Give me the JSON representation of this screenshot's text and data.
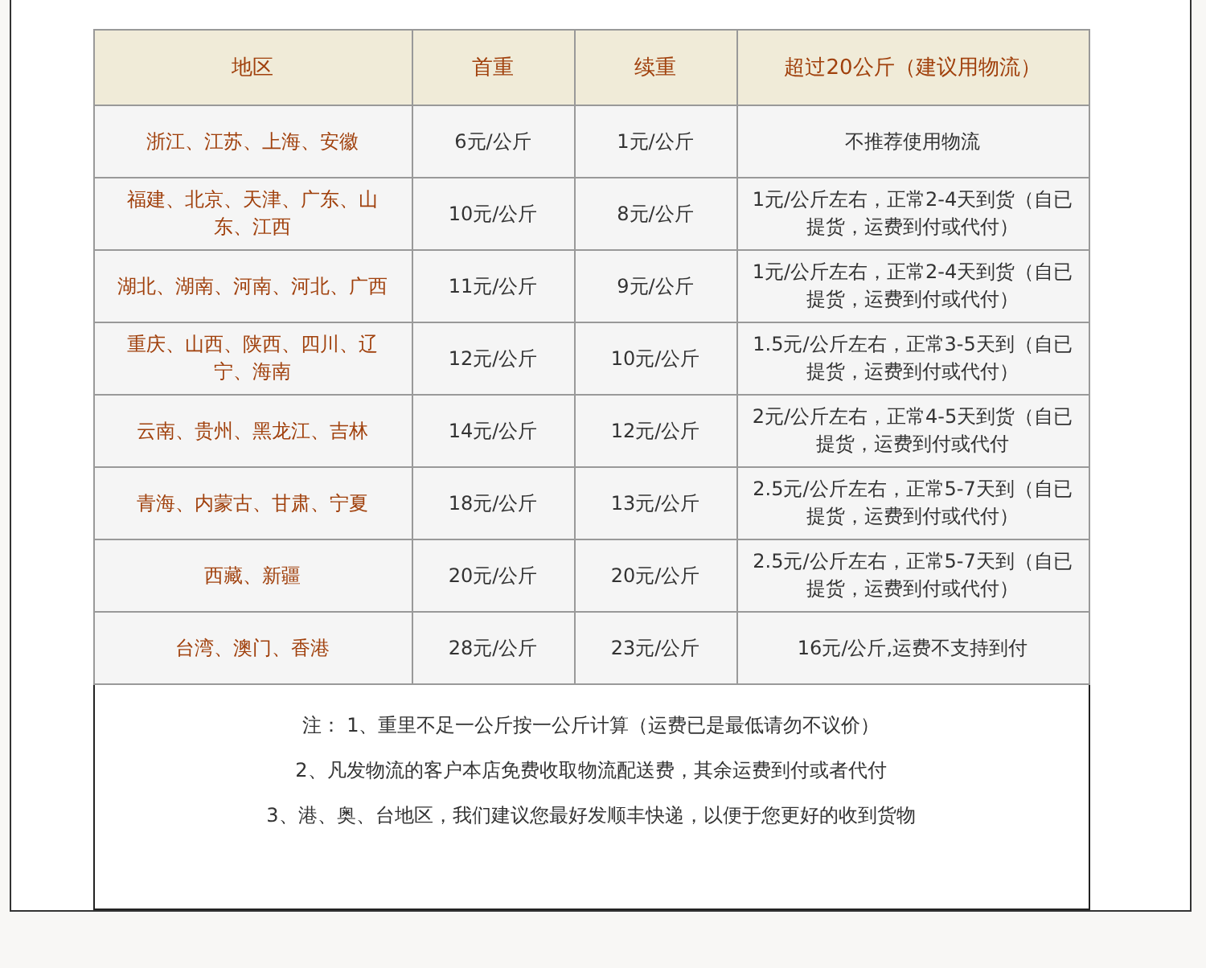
{
  "table": {
    "columns": [
      "地区",
      "首重",
      "续重",
      "超过20公斤（建议用物流）"
    ],
    "rows": [
      {
        "region": "浙江、江苏、上海、安徽",
        "first_weight": "6元/公斤",
        "extra_weight": "1元/公斤",
        "over_20kg": "不推荐使用物流"
      },
      {
        "region": "福建、北京、天津、广东、山东、江西",
        "first_weight": "10元/公斤",
        "extra_weight": "8元/公斤",
        "over_20kg": "1元/公斤左右，正常2-4天到货（自已提货，运费到付或代付）"
      },
      {
        "region": "湖北、湖南、河南、河北、广西",
        "first_weight": "11元/公斤",
        "extra_weight": "9元/公斤",
        "over_20kg": "1元/公斤左右，正常2-4天到货（自已提货，运费到付或代付）"
      },
      {
        "region": "重庆、山西、陕西、四川、辽宁、海南",
        "first_weight": "12元/公斤",
        "extra_weight": "10元/公斤",
        "over_20kg": "1.5元/公斤左右，正常3-5天到（自已提货，运费到付或代付）"
      },
      {
        "region": "云南、贵州、黑龙江、吉林",
        "first_weight": "14元/公斤",
        "extra_weight": "12元/公斤",
        "over_20kg": "2元/公斤左右，正常4-5天到货（自已提货，运费到付或代付"
      },
      {
        "region": "青海、内蒙古、甘肃、宁夏",
        "first_weight": "18元/公斤",
        "extra_weight": "13元/公斤",
        "over_20kg": "2.5元/公斤左右，正常5-7天到（自已提货，运费到付或代付）"
      },
      {
        "region": "西藏、新疆",
        "first_weight": "20元/公斤",
        "extra_weight": "20元/公斤",
        "over_20kg": "2.5元/公斤左右，正常5-7天到（自已提货，运费到付或代付）"
      },
      {
        "region": "台湾、澳门、香港",
        "first_weight": "28元/公斤",
        "extra_weight": "23元/公斤",
        "over_20kg": "16元/公斤,运费不支持到付"
      }
    ]
  },
  "notes": [
    "注： 1、重里不足一公斤按一公斤计算（运费已是最低请勿不议价）",
    "2、凡发物流的客户本店免费收取物流配送费，其余运费到付或者代付",
    "3、港、奥、台地区，我们建议您最好发顺丰快递，以便于您更好的收到货物"
  ]
}
